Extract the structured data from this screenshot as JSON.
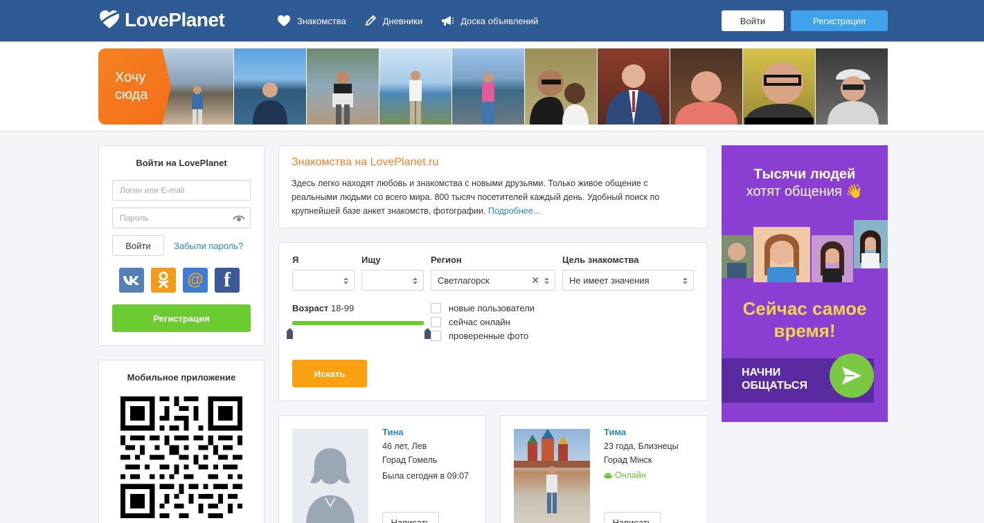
{
  "header": {
    "logo_text": "LovePlanet",
    "nav": [
      {
        "label": "Знакомства",
        "icon": "heart-icon"
      },
      {
        "label": "Дневники",
        "icon": "pencil-icon"
      },
      {
        "label": "Доска объявлений",
        "icon": "megaphone-icon"
      }
    ],
    "login_label": "Войти",
    "register_label": "Регистрация"
  },
  "strip": {
    "cta_label": "Хочу сюда",
    "photos_count": 10
  },
  "login": {
    "title": "Войти на LovePlanet",
    "login_placeholder": "Логин или E-mail",
    "password_placeholder": "Пароль",
    "enter_label": "Войти",
    "forgot_label": "Забыли пароль?",
    "socials": [
      {
        "name": "vk",
        "icon": "vk-icon",
        "color": "#5181b8"
      },
      {
        "name": "ok",
        "icon": "odnoklassniki-icon",
        "color": "#f59a16"
      },
      {
        "name": "mail",
        "icon": "mailru-icon",
        "color": "#3d7dd6"
      },
      {
        "name": "facebook",
        "icon": "facebook-icon",
        "color": "#3b5998"
      }
    ],
    "register_label": "Регистрация"
  },
  "mobile": {
    "title": "Мобильное приложение"
  },
  "intro": {
    "title": "Знакомства на LovePlanet.ru",
    "text": "Здесь легко находят любовь и знакомства с новыми друзьями. Только живое общение с реальными людьми со всего мира. 800 тысяч посетителей каждый день. Удобный поиск по крупнейшей базе анкет знакомств, фотографии. ",
    "more_label": "Подробнее..."
  },
  "search": {
    "i_label": "Я",
    "seek_label": "Ищу",
    "region_label": "Регион",
    "region_value": "Светлагорск",
    "goal_label": "Цель знакомства",
    "goal_value": "Не имеет значения",
    "age_label": "Возраст",
    "age_value": "18-99",
    "checkboxes": [
      "новые пользователи",
      "сейчас онлайн",
      "проверенные фото"
    ],
    "search_label": "Искать"
  },
  "profiles": [
    {
      "name": "Тина",
      "line1": "46 лет, Лев",
      "line2": "Горад Гомель",
      "status": "Была сегодня в 09:07",
      "online": false,
      "write_label": "Написать",
      "photos": "0"
    },
    {
      "name": "Тима",
      "line1": "23 года, Близнецы",
      "line2": "Горад Мінск",
      "status": "Онлайн",
      "online": true,
      "write_label": "Написать",
      "photos": "1"
    }
  ],
  "ad": {
    "title_line1": "Тысячи людей",
    "title_line2": "хотят общения 👋",
    "mid_line1": "Сейчас самое",
    "mid_line2": "время!",
    "cta_line1": "НАЧНИ",
    "cta_line2": "ОБЩАТЬСЯ"
  },
  "colors": {
    "header": "#2e5b94",
    "accent_orange": "#f5821f",
    "green": "#6bcb30",
    "link": "#2a86c9",
    "ad_bg": "#8a3fd2"
  }
}
